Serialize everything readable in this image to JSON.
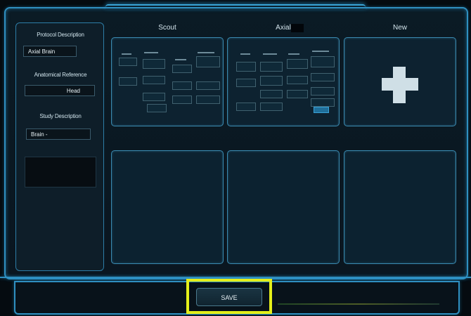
{
  "left_panel": {
    "protocol_description_label": "Protocol Description",
    "protocol_description_value": "Axial Brain",
    "anatomical_reference_label": "Anatomical Reference",
    "anatomical_reference_value": "Head",
    "study_description_label": "Study Description",
    "study_description_value": "Brain -"
  },
  "columns": [
    {
      "title": "Scout"
    },
    {
      "title": "Axial"
    },
    {
      "title": "New"
    }
  ],
  "footer": {
    "save_label": "SAVE"
  },
  "colors": {
    "accent": "#2f8fc0",
    "highlight": "#e4ef1a",
    "background": "#050b10"
  },
  "icons": [
    "plus-icon"
  ]
}
